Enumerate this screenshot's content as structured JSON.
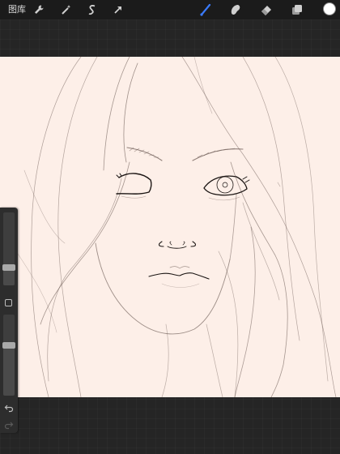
{
  "topbar": {
    "gallery_label": "图库",
    "left_tools": [
      {
        "name": "wrench-icon"
      },
      {
        "name": "magic-wand-icon"
      },
      {
        "name": "selection-icon"
      },
      {
        "name": "transform-arrow-icon"
      }
    ],
    "right_tools": [
      {
        "name": "brush-icon",
        "active": true,
        "color": "#3a7bff"
      },
      {
        "name": "smudge-icon"
      },
      {
        "name": "eraser-icon"
      },
      {
        "name": "layers-icon"
      }
    ],
    "current_color": "#ffffff"
  },
  "canvas": {
    "background": "#fdefe8",
    "stroke_color": "#6b5a54"
  },
  "sidebar": {
    "brush_size_level": 0.25,
    "opacity_level": 0.62,
    "undo_icon": "undo-icon",
    "redo_icon": "redo-icon"
  }
}
